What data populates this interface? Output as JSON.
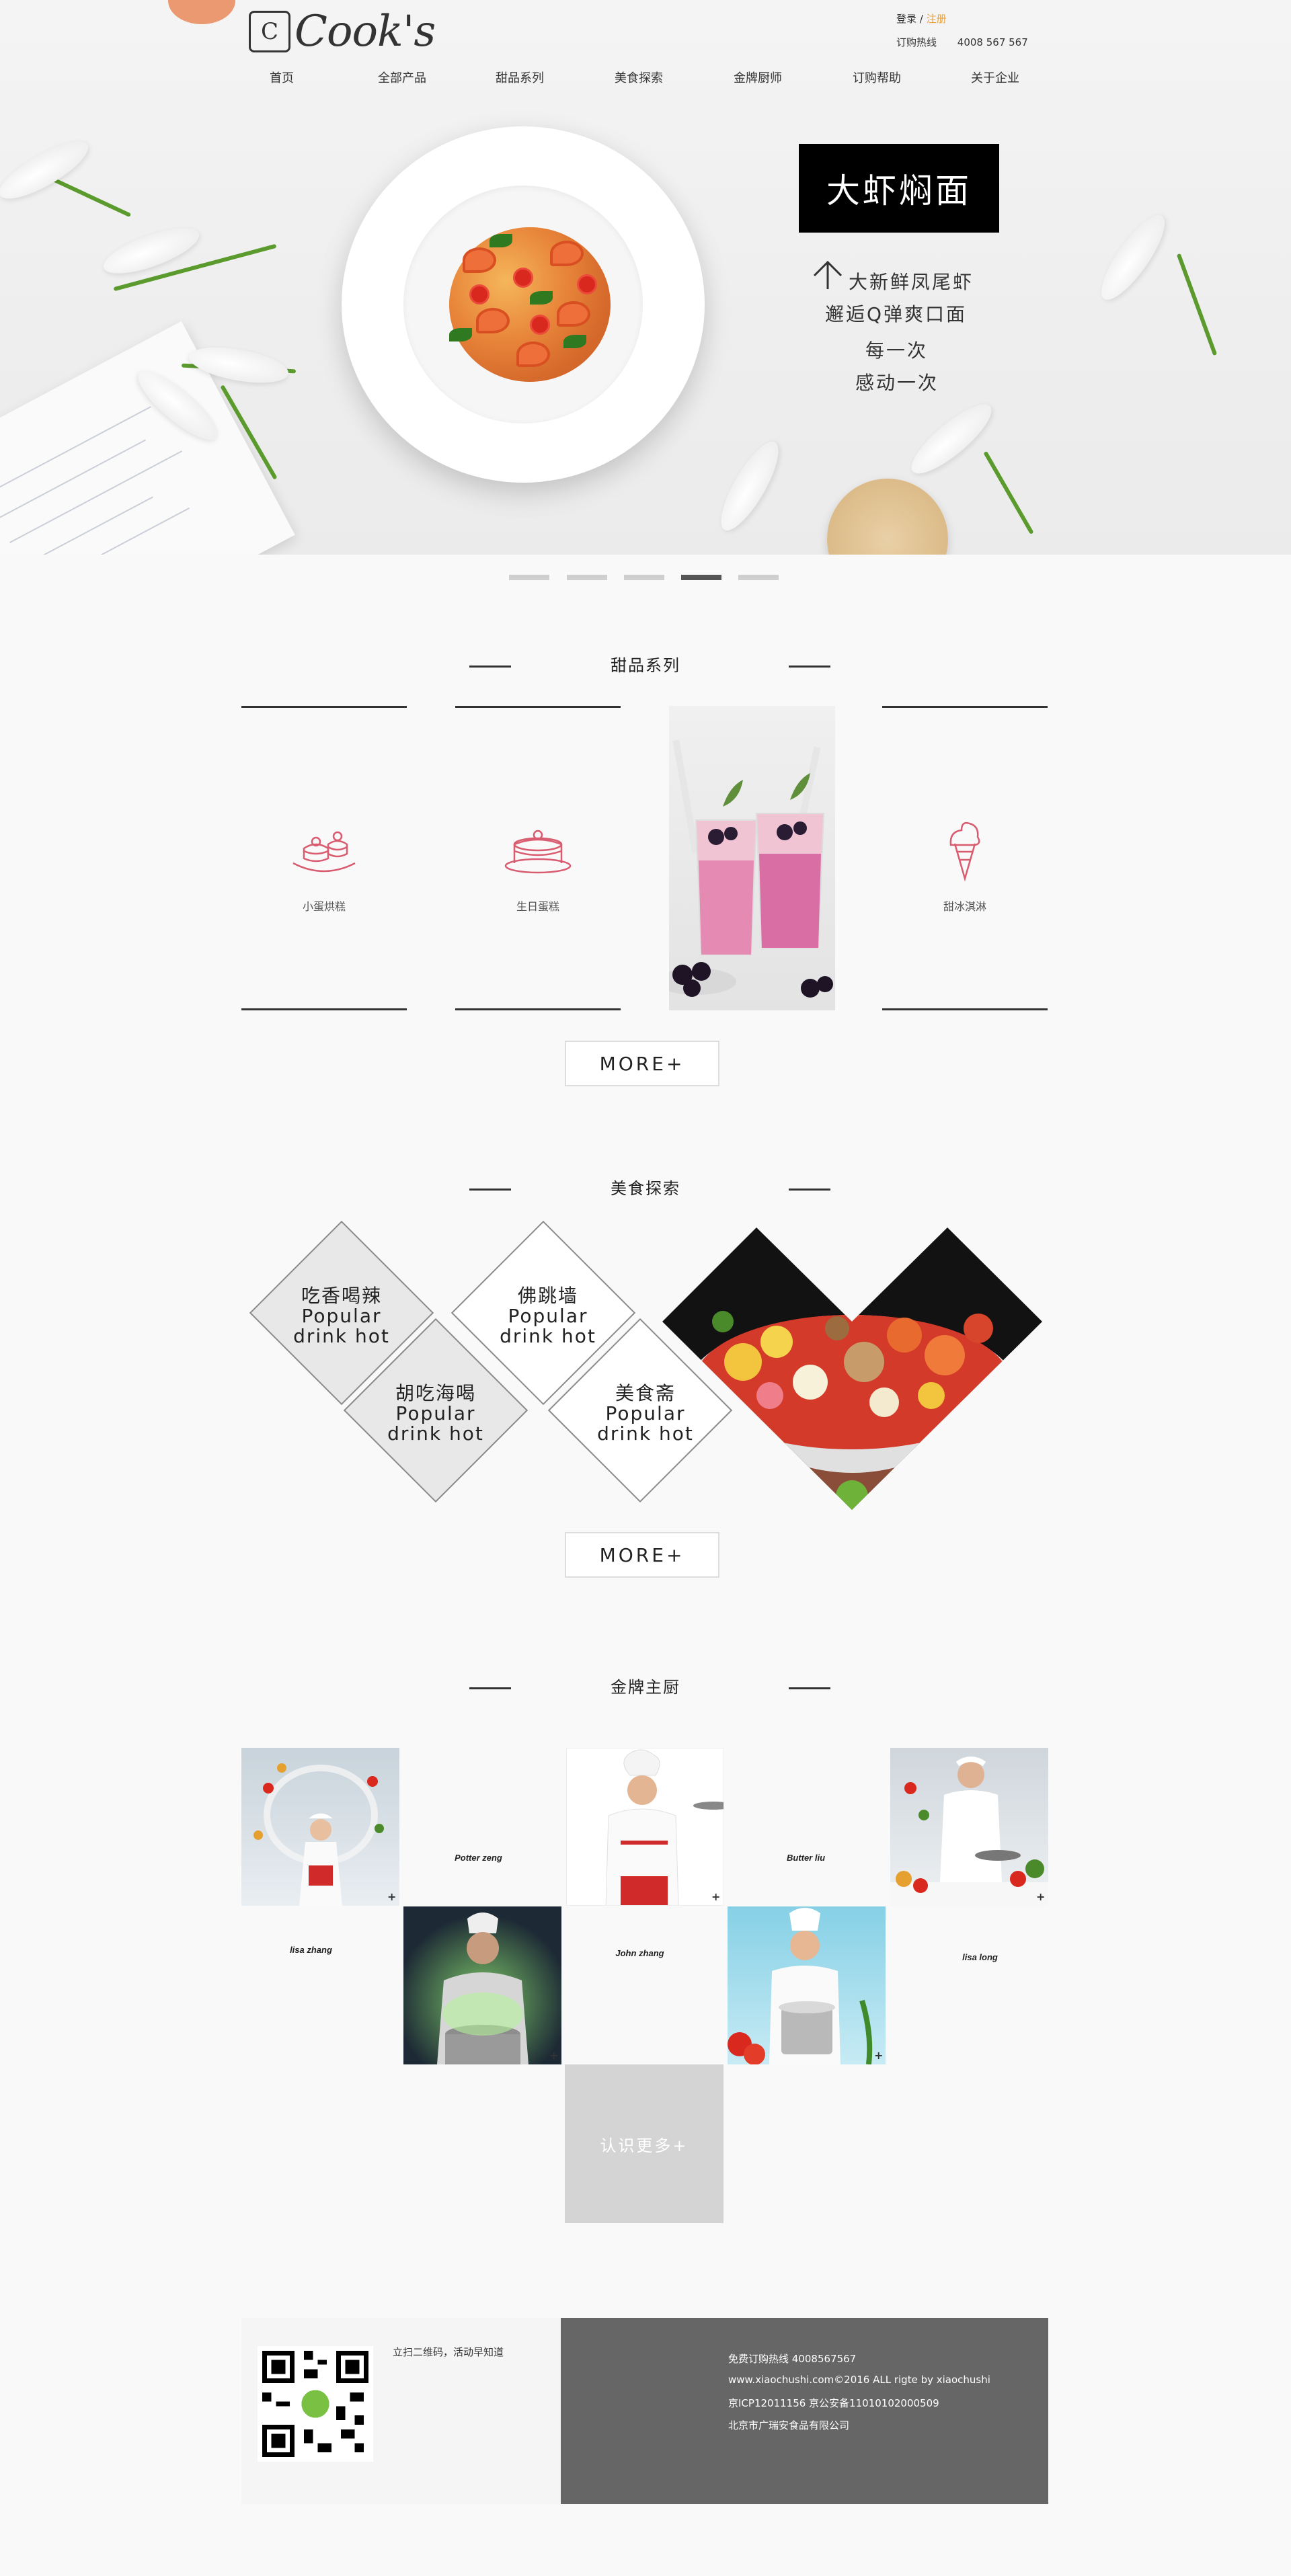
{
  "brand": {
    "logo_text": "Cook's",
    "logo_glyph": "C"
  },
  "header": {
    "login": "登录",
    "separator": "/",
    "register": "注册",
    "hotline_label": "订购热线",
    "hotline_number": "4008 567 567"
  },
  "nav": {
    "items": [
      "首页",
      "全部产品",
      "甜品系列",
      "美食探索",
      "金牌厨师",
      "订购帮助",
      "关于企业"
    ]
  },
  "hero": {
    "title": "大虾焖面",
    "line1": "大新鲜凤尾虾",
    "line2": "邂逅Q弹爽口面",
    "line3": "每一次",
    "line4": "感动一次",
    "slides_total": 5,
    "active_slide": 4
  },
  "desserts": {
    "title": "甜品系列",
    "items": [
      {
        "label": "小蛋烘糕",
        "icon": "cake-icon"
      },
      {
        "label": "生日蛋糕",
        "icon": "birthday-cake-icon"
      },
      {
        "label": "甜冰淇淋",
        "icon": "ice-cream-icon"
      }
    ],
    "more_label": "MORE+"
  },
  "explore": {
    "title": "美食探索",
    "items": [
      {
        "name": "吃香喝辣",
        "en1": "Popular",
        "en2": "drink hot"
      },
      {
        "name": "佛跳墙",
        "en1": "Popular",
        "en2": "drink hot"
      },
      {
        "name": "胡吃海喝",
        "en1": "Popular",
        "en2": "drink hot"
      },
      {
        "name": "美食斋",
        "en1": "Popular",
        "en2": "drink hot"
      }
    ],
    "more_label": "MORE+"
  },
  "chefs": {
    "title": "金牌主厨",
    "names": [
      "lisa zhang",
      "Potter zeng",
      "John zhang",
      "Butter liu",
      "lisa long"
    ],
    "more_label": "认识更多+",
    "plus": "+"
  },
  "footer": {
    "qr_text": "立扫二维码，活动早知道",
    "line1": "免费订购热线 4008567567",
    "line2": "www.xiaochushi.com©2016 ALL rigte by xiaochushi",
    "line3": "京ICP12011156    京公安备11010102000509",
    "line4": "北京市广瑞安食品有限公司"
  },
  "colors": {
    "accent": "#e8a33d",
    "icon_pink": "#d95b6f",
    "footer_dark": "#666666",
    "more_gray": "#d4d4d4"
  }
}
